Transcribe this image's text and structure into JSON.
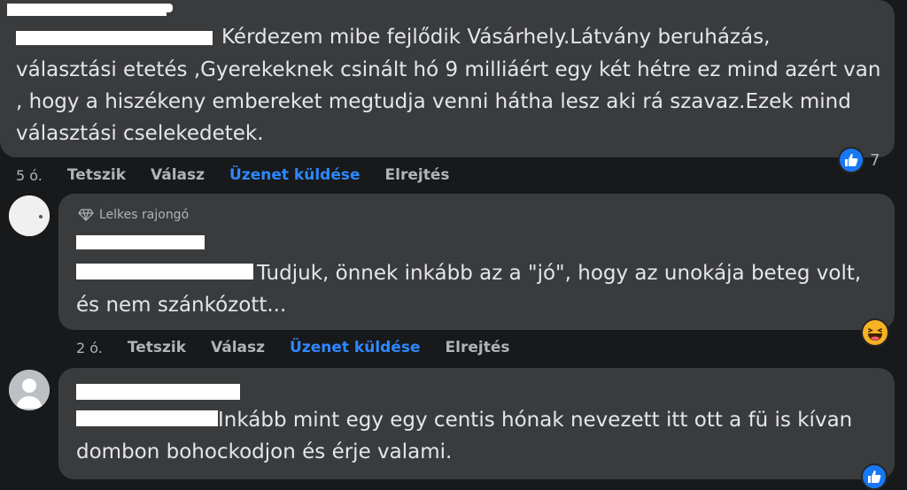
{
  "comment1": {
    "text": "Kérdezem mibe fejlődik Vásárhely.Látvány beruházás, választási etetés ,Gyerekeknek csinált hó 9 milliáért egy két hétre ez mind azért van , hogy a hiszékeny embereket megtudja venni hátha lesz aki rá szavaz.Ezek mind választási cselekedetek.",
    "line1": "Kérdezem mibe fejlődik Vásárhely.Látvány beruházás,",
    "line2": "választási etetés ,Gyerekeknek csinált hó 9 milliáért egy két hétre ez mind azért van",
    "line3": ", hogy a hiszékeny embereket megtudja venni hátha lesz aki rá szavaz.Ezek mind",
    "line4": "választási cselekedetek.",
    "time": "5 ó.",
    "like": "Tetszik",
    "reply": "Válasz",
    "message": "Üzenet küldése",
    "hide": "Elrejtés",
    "reaction": "like-icon",
    "reaction_count": "7"
  },
  "comment2": {
    "badge": "Lelkes rajongó",
    "line1": "Tudjuk, önnek inkább az a \"jó\", hogy az unokája beteg volt,",
    "line2": "és nem szánkózott...",
    "time": "2 ó.",
    "like": "Tetszik",
    "reply": "Válasz",
    "message": "Üzenet küldése",
    "hide": "Elrejtés",
    "reaction": "haha-icon"
  },
  "comment3": {
    "line1": "Inkább mint egy egy centis hónak nevezett itt ott a fü is kívan",
    "line2": "dombon bohockodjon és érje valami.",
    "reaction": "like-icon"
  },
  "colors": {
    "background": "#18191a",
    "bubble": "#3a3b3c",
    "text": "#e4e6eb",
    "muted": "#b0b3b8",
    "link": "#2d88ff",
    "like": "#1877f2",
    "haha": "#f7b125"
  }
}
